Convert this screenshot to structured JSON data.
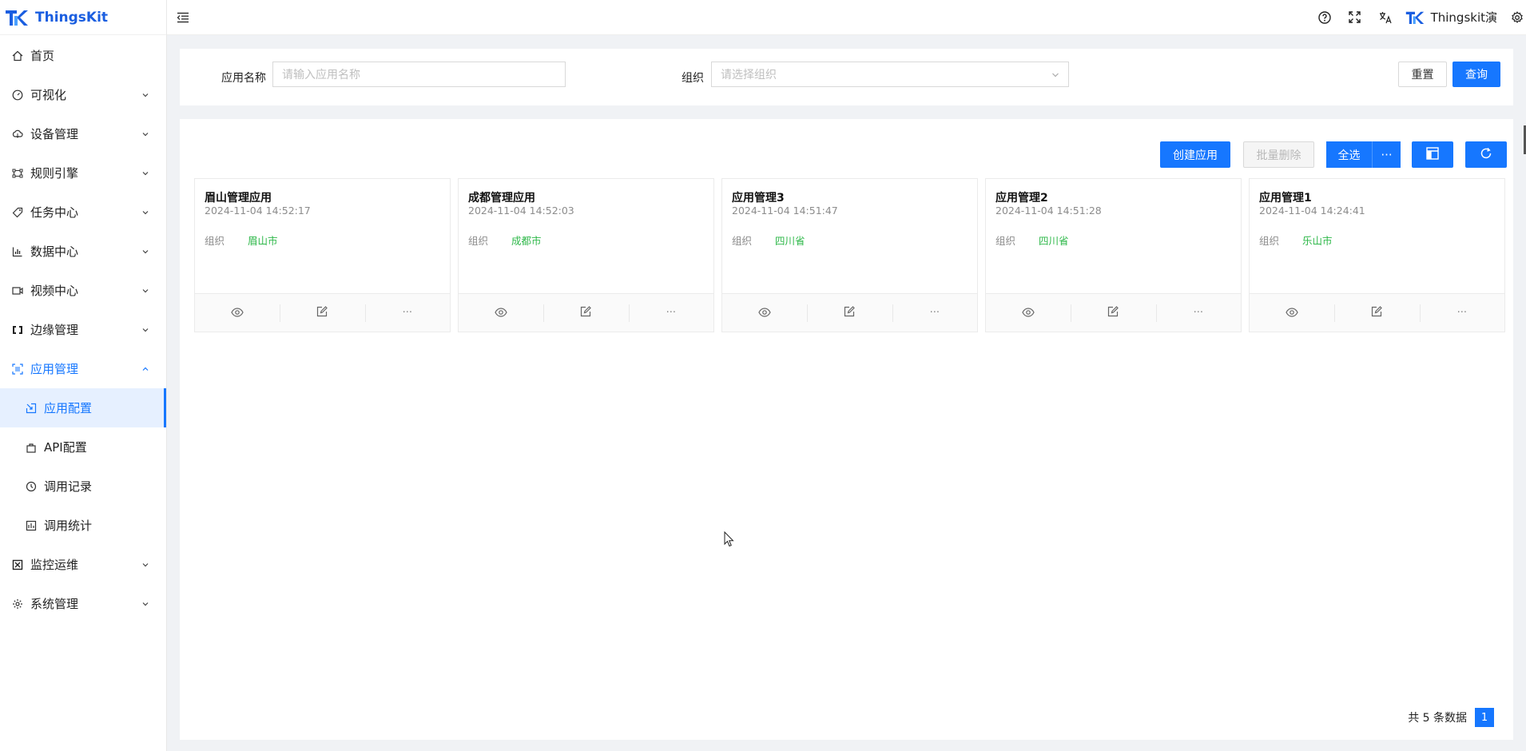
{
  "brand": {
    "name": "ThingsKit"
  },
  "header": {
    "user_name": "Thingskit演"
  },
  "sidebar": {
    "items": [
      {
        "label": "首页",
        "icon": "home-icon"
      },
      {
        "label": "可视化",
        "icon": "dashboard-icon"
      },
      {
        "label": "设备管理",
        "icon": "cloud-device-icon"
      },
      {
        "label": "规则引擎",
        "icon": "rule-engine-icon"
      },
      {
        "label": "任务中心",
        "icon": "tag-icon"
      },
      {
        "label": "数据中心",
        "icon": "bar-chart-icon"
      },
      {
        "label": "视频中心",
        "icon": "video-icon"
      },
      {
        "label": "边缘管理",
        "icon": "edge-icon"
      },
      {
        "label": "应用管理",
        "icon": "app-icon"
      },
      {
        "label": "监控运维",
        "icon": "monitor-icon"
      },
      {
        "label": "系统管理",
        "icon": "settings-icon"
      }
    ],
    "sub_items": [
      {
        "label": "应用配置",
        "icon": "app-config-icon"
      },
      {
        "label": "API配置",
        "icon": "bag-icon"
      },
      {
        "label": "调用记录",
        "icon": "history-icon"
      },
      {
        "label": "调用统计",
        "icon": "stats-icon"
      }
    ]
  },
  "search": {
    "app_name_label": "应用名称",
    "app_name_placeholder": "请输入应用名称",
    "org_label": "组织",
    "org_placeholder": "请选择组织",
    "reset_label": "重置",
    "query_label": "查询"
  },
  "toolbar": {
    "create_label": "创建应用",
    "batch_delete_label": "批量删除",
    "select_all_label": "全选",
    "more_label": "···"
  },
  "cards": [
    {
      "title": "眉山管理应用",
      "time": "2024-11-04 14:52:17",
      "org_label": "组织",
      "org": "眉山市"
    },
    {
      "title": "成都管理应用",
      "time": "2024-11-04 14:52:03",
      "org_label": "组织",
      "org": "成都市"
    },
    {
      "title": "应用管理3",
      "time": "2024-11-04 14:51:47",
      "org_label": "组织",
      "org": "四川省"
    },
    {
      "title": "应用管理2",
      "time": "2024-11-04 14:51:28",
      "org_label": "组织",
      "org": "四川省"
    },
    {
      "title": "应用管理1",
      "time": "2024-11-04 14:24:41",
      "org_label": "组织",
      "org": "乐山市"
    }
  ],
  "card_more_label": "···",
  "pagination": {
    "total_text": "共 5 条数据",
    "current_page": "1"
  },
  "colors": {
    "primary": "#1677ff",
    "org_green": "#2fb84a",
    "brand": "#1a5ee0"
  }
}
